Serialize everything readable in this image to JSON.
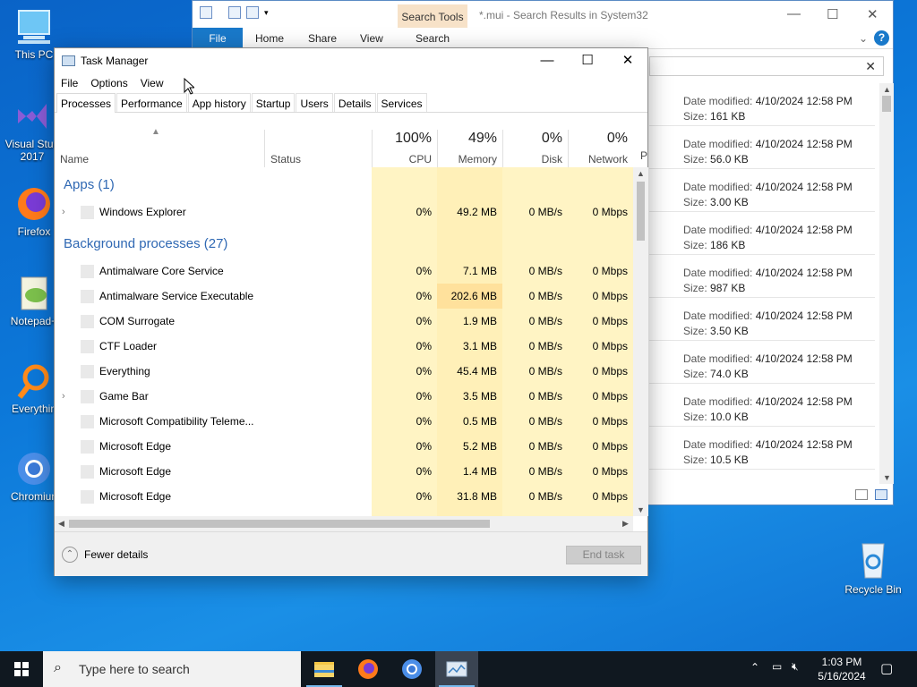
{
  "desktop": {
    "icons": [
      {
        "label": "This PC"
      },
      {
        "label": "Visual Studio 2017",
        "line1": "Visual Stud",
        "line2": "2017"
      },
      {
        "label": "Firefox"
      },
      {
        "label": "Notepad+"
      },
      {
        "label": "Everythin"
      },
      {
        "label": "Chromiun"
      }
    ],
    "recycle_bin": "Recycle Bin"
  },
  "explorer": {
    "title": "*.mui - Search Results in System32",
    "contextual_tab": "Search Tools",
    "ribbon_tabs": [
      "File",
      "Home",
      "Share",
      "View",
      "Search"
    ],
    "help": "?",
    "items": [
      {
        "date_label": "Date modified:",
        "date": "4/10/2024 12:58 PM",
        "size_label": "Size:",
        "size": "161 KB"
      },
      {
        "date_label": "Date modified:",
        "date": "4/10/2024 12:58 PM",
        "size_label": "Size:",
        "size": "56.0 KB"
      },
      {
        "date_label": "Date modified:",
        "date": "4/10/2024 12:58 PM",
        "size_label": "Size:",
        "size": "3.00 KB"
      },
      {
        "date_label": "Date modified:",
        "date": "4/10/2024 12:58 PM",
        "size_label": "Size:",
        "size": "186 KB"
      },
      {
        "date_label": "Date modified:",
        "date": "4/10/2024 12:58 PM",
        "size_label": "Size:",
        "size": "987 KB"
      },
      {
        "date_label": "Date modified:",
        "date": "4/10/2024 12:58 PM",
        "size_label": "Size:",
        "size": "3.50 KB"
      },
      {
        "date_label": "Date modified:",
        "date": "4/10/2024 12:58 PM",
        "size_label": "Size:",
        "size": "74.0 KB"
      },
      {
        "date_label": "Date modified:",
        "date": "4/10/2024 12:58 PM",
        "size_label": "Size:",
        "size": "10.0 KB"
      },
      {
        "date_label": "Date modified:",
        "date": "4/10/2024 12:58 PM",
        "size_label": "Size:",
        "size": "10.5 KB"
      }
    ]
  },
  "taskmgr": {
    "title": "Task Manager",
    "menu": [
      "File",
      "Options",
      "View"
    ],
    "tabs": [
      "Processes",
      "Performance",
      "App history",
      "Startup",
      "Users",
      "Details",
      "Services"
    ],
    "columns": {
      "name": "Name",
      "status": "Status",
      "cpu": {
        "pct": "100%",
        "label": "CPU"
      },
      "memory": {
        "pct": "49%",
        "label": "Memory"
      },
      "disk": {
        "pct": "0%",
        "label": "Disk"
      },
      "network": {
        "pct": "0%",
        "label": "Network"
      },
      "extra": "P"
    },
    "groups": {
      "apps": "Apps (1)",
      "background": "Background processes (27)"
    },
    "apps": [
      {
        "name": "Windows Explorer",
        "cpu": "0%",
        "mem": "49.2 MB",
        "disk": "0 MB/s",
        "net": "0 Mbps",
        "expandable": true
      }
    ],
    "background": [
      {
        "name": "Antimalware Core Service",
        "cpu": "0%",
        "mem": "7.1 MB",
        "disk": "0 MB/s",
        "net": "0 Mbps",
        "expandable": false
      },
      {
        "name": "Antimalware Service Executable",
        "cpu": "0%",
        "mem": "202.6 MB",
        "disk": "0 MB/s",
        "net": "0 Mbps",
        "expandable": false
      },
      {
        "name": "COM Surrogate",
        "cpu": "0%",
        "mem": "1.9 MB",
        "disk": "0 MB/s",
        "net": "0 Mbps",
        "expandable": false
      },
      {
        "name": "CTF Loader",
        "cpu": "0%",
        "mem": "3.1 MB",
        "disk": "0 MB/s",
        "net": "0 Mbps",
        "expandable": false
      },
      {
        "name": "Everything",
        "cpu": "0%",
        "mem": "45.4 MB",
        "disk": "0 MB/s",
        "net": "0 Mbps",
        "expandable": false
      },
      {
        "name": "Game Bar",
        "cpu": "0%",
        "mem": "3.5 MB",
        "disk": "0 MB/s",
        "net": "0 Mbps",
        "expandable": true
      },
      {
        "name": "Microsoft Compatibility Teleme...",
        "cpu": "0%",
        "mem": "0.5 MB",
        "disk": "0 MB/s",
        "net": "0 Mbps",
        "expandable": false
      },
      {
        "name": "Microsoft Edge",
        "cpu": "0%",
        "mem": "5.2 MB",
        "disk": "0 MB/s",
        "net": "0 Mbps",
        "expandable": false
      },
      {
        "name": "Microsoft Edge",
        "cpu": "0%",
        "mem": "1.4 MB",
        "disk": "0 MB/s",
        "net": "0 Mbps",
        "expandable": false
      },
      {
        "name": "Microsoft Edge",
        "cpu": "0%",
        "mem": "31.8 MB",
        "disk": "0 MB/s",
        "net": "0 Mbps",
        "expandable": false
      }
    ],
    "footer": {
      "fewer_details": "Fewer details",
      "end_task": "End task"
    },
    "colors": {
      "cpu_cell": "#fff4c4",
      "mem_cell": "#fff0b8",
      "mem_high": "#ffe19c",
      "group_text": "#2f68b3"
    }
  },
  "taskbar": {
    "search_placeholder": "Type here to search",
    "time": "1:03 PM",
    "date": "5/16/2024"
  }
}
